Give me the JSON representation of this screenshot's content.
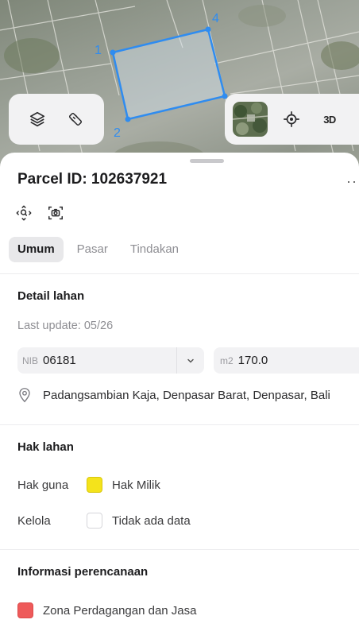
{
  "map": {
    "vertex_labels": [
      "1",
      "2",
      "4"
    ],
    "polygon_color": "#2f8cf0",
    "icons": {
      "layers": "layers-icon",
      "measure": "ruler-icon",
      "satellite": "satellite-thumbnail",
      "locate": "crosshair-icon"
    },
    "three_d_label": "3D"
  },
  "parcel": {
    "title": "Parcel ID: 102637921",
    "more": "···"
  },
  "tabs": [
    {
      "label": "Umum",
      "active": true
    },
    {
      "label": "Pasar",
      "active": false
    },
    {
      "label": "Tindakan",
      "active": false
    }
  ],
  "detail": {
    "heading": "Detail lahan",
    "last_update": "Last update: 05/26",
    "nib_prefix": "NIB",
    "nib_value": "06181",
    "area_prefix": "m2",
    "area_value": "170.0",
    "address": "Padangsambian Kaja, Denpasar Barat, Denpasar, Bali"
  },
  "rights": {
    "heading": "Hak lahan",
    "rows": [
      {
        "label": "Hak guna",
        "value": "Hak Milik",
        "color": "#f4e31b"
      },
      {
        "label": "Kelola",
        "value": "Tidak ada data",
        "color": "#ffffff"
      }
    ]
  },
  "planning": {
    "heading": "Informasi perencanaan",
    "zone": "Zona Perdagangan dan Jasa",
    "zone_color": "#ee5a5a"
  }
}
